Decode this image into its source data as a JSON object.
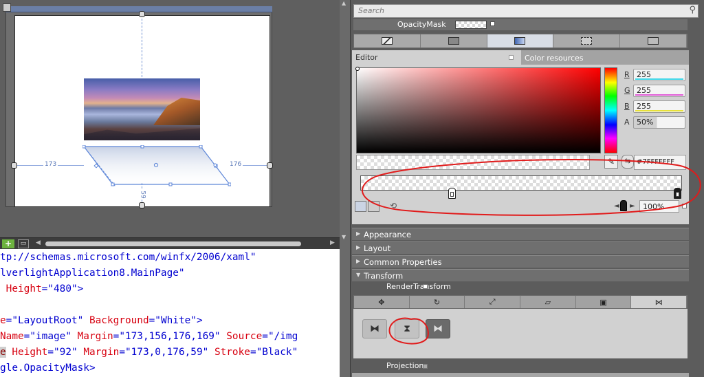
{
  "design": {
    "margin_left": "173",
    "margin_right": "176",
    "margin_bottom": "59"
  },
  "xaml": {
    "lines": [
      [
        {
          "t": "tp://schemas.microsoft.com/winfx/2006/xaml\"",
          "c": "t-v"
        }
      ],
      [
        {
          "t": "lverlightApplication8.MainPage\"",
          "c": "t-v"
        }
      ],
      [
        {
          "t": " Height",
          "c": "t-a"
        },
        {
          "t": "=",
          "c": "t-p"
        },
        {
          "t": "\"480\">",
          "c": "t-v"
        }
      ],
      [],
      [
        {
          "t": "e",
          "c": "t-a"
        },
        {
          "t": "=",
          "c": "t-p"
        },
        {
          "t": "\"LayoutRoot\"",
          "c": "t-v"
        },
        {
          "t": " Background",
          "c": "t-a"
        },
        {
          "t": "=",
          "c": "t-p"
        },
        {
          "t": "\"White\">",
          "c": "t-v"
        }
      ],
      [
        {
          "t": "Name",
          "c": "t-a"
        },
        {
          "t": "=",
          "c": "t-p"
        },
        {
          "t": "\"image\"",
          "c": "t-v"
        },
        {
          "t": " Margin",
          "c": "t-a"
        },
        {
          "t": "=",
          "c": "t-p"
        },
        {
          "t": "\"173,156,176,169\"",
          "c": "t-v"
        },
        {
          "t": " Source",
          "c": "t-a"
        },
        {
          "t": "=",
          "c": "t-p"
        },
        {
          "t": "\"/img",
          "c": "t-v"
        }
      ],
      [
        {
          "t": "e",
          "c": "t-hl"
        },
        {
          "t": " Height",
          "c": "t-a"
        },
        {
          "t": "=",
          "c": "t-p"
        },
        {
          "t": "\"92\"",
          "c": "t-v"
        },
        {
          "t": " Margin",
          "c": "t-a"
        },
        {
          "t": "=",
          "c": "t-p"
        },
        {
          "t": "\"173,0,176,59\"",
          "c": "t-v"
        },
        {
          "t": " Stroke",
          "c": "t-a"
        },
        {
          "t": "=",
          "c": "t-p"
        },
        {
          "t": "\"Black\"",
          "c": "t-v"
        }
      ],
      [
        {
          "t": "gle.OpacityMask>",
          "c": "t-v"
        }
      ]
    ]
  },
  "search": {
    "placeholder": "Search"
  },
  "opacity_mask": {
    "label": "OpacityMask"
  },
  "editor": {
    "tab_editor": "Editor",
    "tab_color_resources": "Color resources",
    "channels": [
      {
        "letter": "R",
        "value": "255",
        "bar_color": "#3fd7e8"
      },
      {
        "letter": "G",
        "value": "255",
        "bar_color": "#e05ad6"
      },
      {
        "letter": "B",
        "value": "255",
        "bar_color": "#e8e23a"
      },
      {
        "letter": "A",
        "value": "50%",
        "bar_color": "#ffffff"
      }
    ],
    "hex": "#7FFFFFFF",
    "stop_offset": "100%"
  },
  "sections": {
    "appearance": "Appearance",
    "layout": "Layout",
    "common": "Common Properties",
    "transform": "Transform",
    "render_transform": "RenderTransform",
    "projection": "Projection"
  },
  "colors": {
    "accent_blue": "#6d8fd1",
    "annotation_red": "#e11b1b"
  }
}
